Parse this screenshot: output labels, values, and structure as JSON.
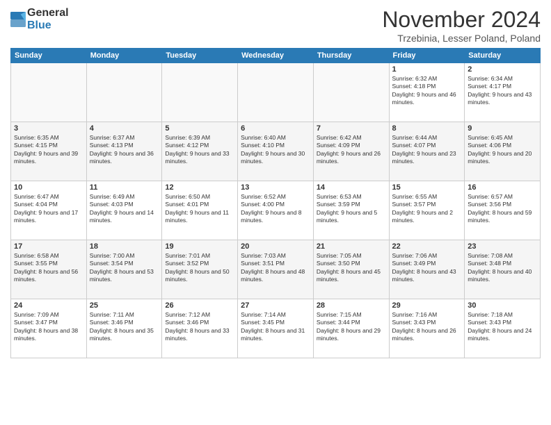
{
  "header": {
    "logo": {
      "line1": "General",
      "line2": "Blue"
    },
    "title": "November 2024",
    "location": "Trzebinia, Lesser Poland, Poland"
  },
  "weekdays": [
    "Sunday",
    "Monday",
    "Tuesday",
    "Wednesday",
    "Thursday",
    "Friday",
    "Saturday"
  ],
  "weeks": [
    [
      {
        "day": null
      },
      {
        "day": null
      },
      {
        "day": null
      },
      {
        "day": null
      },
      {
        "day": null
      },
      {
        "day": 1,
        "sunrise": "6:32 AM",
        "sunset": "4:18 PM",
        "daylight": "9 hours and 46 minutes."
      },
      {
        "day": 2,
        "sunrise": "6:34 AM",
        "sunset": "4:17 PM",
        "daylight": "9 hours and 43 minutes."
      }
    ],
    [
      {
        "day": 3,
        "sunrise": "6:35 AM",
        "sunset": "4:15 PM",
        "daylight": "9 hours and 39 minutes."
      },
      {
        "day": 4,
        "sunrise": "6:37 AM",
        "sunset": "4:13 PM",
        "daylight": "9 hours and 36 minutes."
      },
      {
        "day": 5,
        "sunrise": "6:39 AM",
        "sunset": "4:12 PM",
        "daylight": "9 hours and 33 minutes."
      },
      {
        "day": 6,
        "sunrise": "6:40 AM",
        "sunset": "4:10 PM",
        "daylight": "9 hours and 30 minutes."
      },
      {
        "day": 7,
        "sunrise": "6:42 AM",
        "sunset": "4:09 PM",
        "daylight": "9 hours and 26 minutes."
      },
      {
        "day": 8,
        "sunrise": "6:44 AM",
        "sunset": "4:07 PM",
        "daylight": "9 hours and 23 minutes."
      },
      {
        "day": 9,
        "sunrise": "6:45 AM",
        "sunset": "4:06 PM",
        "daylight": "9 hours and 20 minutes."
      }
    ],
    [
      {
        "day": 10,
        "sunrise": "6:47 AM",
        "sunset": "4:04 PM",
        "daylight": "9 hours and 17 minutes."
      },
      {
        "day": 11,
        "sunrise": "6:49 AM",
        "sunset": "4:03 PM",
        "daylight": "9 hours and 14 minutes."
      },
      {
        "day": 12,
        "sunrise": "6:50 AM",
        "sunset": "4:01 PM",
        "daylight": "9 hours and 11 minutes."
      },
      {
        "day": 13,
        "sunrise": "6:52 AM",
        "sunset": "4:00 PM",
        "daylight": "9 hours and 8 minutes."
      },
      {
        "day": 14,
        "sunrise": "6:53 AM",
        "sunset": "3:59 PM",
        "daylight": "9 hours and 5 minutes."
      },
      {
        "day": 15,
        "sunrise": "6:55 AM",
        "sunset": "3:57 PM",
        "daylight": "9 hours and 2 minutes."
      },
      {
        "day": 16,
        "sunrise": "6:57 AM",
        "sunset": "3:56 PM",
        "daylight": "8 hours and 59 minutes."
      }
    ],
    [
      {
        "day": 17,
        "sunrise": "6:58 AM",
        "sunset": "3:55 PM",
        "daylight": "8 hours and 56 minutes."
      },
      {
        "day": 18,
        "sunrise": "7:00 AM",
        "sunset": "3:54 PM",
        "daylight": "8 hours and 53 minutes."
      },
      {
        "day": 19,
        "sunrise": "7:01 AM",
        "sunset": "3:52 PM",
        "daylight": "8 hours and 50 minutes."
      },
      {
        "day": 20,
        "sunrise": "7:03 AM",
        "sunset": "3:51 PM",
        "daylight": "8 hours and 48 minutes."
      },
      {
        "day": 21,
        "sunrise": "7:05 AM",
        "sunset": "3:50 PM",
        "daylight": "8 hours and 45 minutes."
      },
      {
        "day": 22,
        "sunrise": "7:06 AM",
        "sunset": "3:49 PM",
        "daylight": "8 hours and 43 minutes."
      },
      {
        "day": 23,
        "sunrise": "7:08 AM",
        "sunset": "3:48 PM",
        "daylight": "8 hours and 40 minutes."
      }
    ],
    [
      {
        "day": 24,
        "sunrise": "7:09 AM",
        "sunset": "3:47 PM",
        "daylight": "8 hours and 38 minutes."
      },
      {
        "day": 25,
        "sunrise": "7:11 AM",
        "sunset": "3:46 PM",
        "daylight": "8 hours and 35 minutes."
      },
      {
        "day": 26,
        "sunrise": "7:12 AM",
        "sunset": "3:46 PM",
        "daylight": "8 hours and 33 minutes."
      },
      {
        "day": 27,
        "sunrise": "7:14 AM",
        "sunset": "3:45 PM",
        "daylight": "8 hours and 31 minutes."
      },
      {
        "day": 28,
        "sunrise": "7:15 AM",
        "sunset": "3:44 PM",
        "daylight": "8 hours and 29 minutes."
      },
      {
        "day": 29,
        "sunrise": "7:16 AM",
        "sunset": "3:43 PM",
        "daylight": "8 hours and 26 minutes."
      },
      {
        "day": 30,
        "sunrise": "7:18 AM",
        "sunset": "3:43 PM",
        "daylight": "8 hours and 24 minutes."
      }
    ]
  ],
  "labels": {
    "sunrise": "Sunrise:",
    "sunset": "Sunset:",
    "daylight": "Daylight:"
  }
}
